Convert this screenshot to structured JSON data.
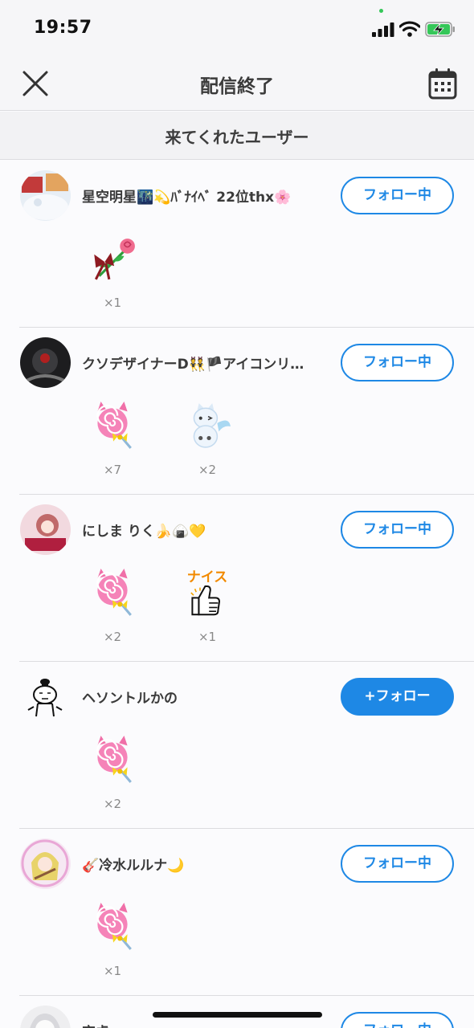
{
  "status_bar": {
    "time": "19:57"
  },
  "nav": {
    "title": "配信終了",
    "close_icon": "close-icon",
    "calendar_icon": "calendar-icon"
  },
  "section": {
    "title": "来てくれたユーザー"
  },
  "users": [
    {
      "name": "星空明星🌃💫ﾊﾞﾅｲﾍﾞ 22位thx🌸",
      "follow_label": "フォロー中",
      "following": true,
      "gifts": [
        {
          "icon": "rose-ribbon-gift",
          "count": "×1"
        }
      ]
    },
    {
      "name": "クソデザイナーD👯🏴アイコンリ…",
      "follow_label": "フォロー中",
      "following": true,
      "gifts": [
        {
          "icon": "lollipop-gift",
          "count": "×7"
        },
        {
          "icon": "ghost-cat-gift",
          "count": "×2"
        }
      ]
    },
    {
      "name": "にしま りく🍌🍙💛",
      "follow_label": "フォロー中",
      "following": true,
      "gifts": [
        {
          "icon": "lollipop-gift",
          "count": "×2"
        },
        {
          "icon": "nice-thumbs-up-gift",
          "count": "×1",
          "text": "ナイス"
        }
      ]
    },
    {
      "name": "ヘソントルかの",
      "follow_label": "+フォロー",
      "following": false,
      "gifts": [
        {
          "icon": "lollipop-gift",
          "count": "×2"
        }
      ]
    },
    {
      "name": "🎸冷水ルルナ🌙",
      "follow_label": "フォロー中",
      "following": true,
      "gifts": [
        {
          "icon": "lollipop-gift",
          "count": "×1"
        }
      ]
    },
    {
      "name": "空虚",
      "follow_label": "フォロー中",
      "following": true,
      "gifts": []
    }
  ],
  "colors": {
    "accent": "#1e88e5",
    "text": "#3a3a3a",
    "muted": "#888888"
  }
}
